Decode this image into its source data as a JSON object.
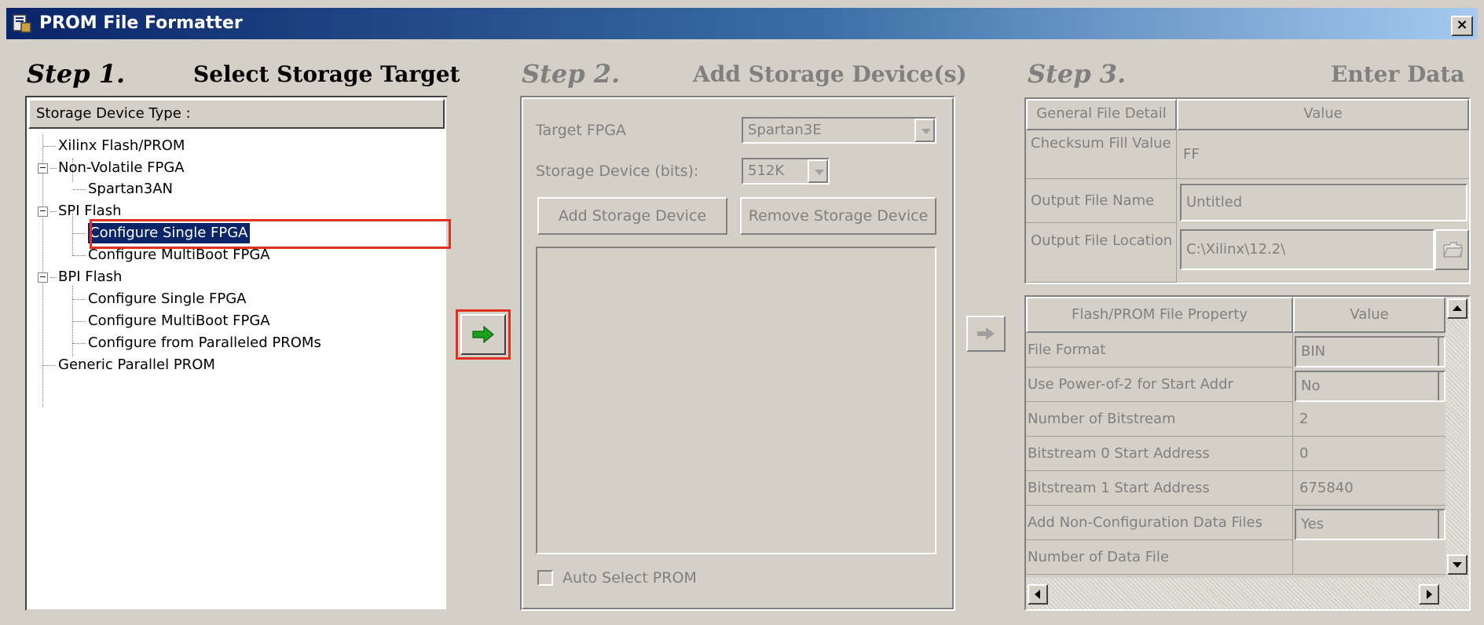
{
  "window": {
    "title": "PROM File Formatter",
    "close_glyph": "×"
  },
  "step1": {
    "num": "Step 1.",
    "title": "Select Storage Target",
    "tree_header": "Storage Device Type :",
    "items": [
      {
        "label": "Xilinx Flash/PROM"
      },
      {
        "label": "Non-Volatile FPGA",
        "expander": "−"
      },
      {
        "label": "Spartan3AN"
      },
      {
        "label": "SPI Flash",
        "expander": "−"
      },
      {
        "label": "Configure Single FPGA",
        "selected": true
      },
      {
        "label": "Configure MultiBoot FPGA"
      },
      {
        "label": "BPI Flash",
        "expander": "−"
      },
      {
        "label": "Configure Single FPGA"
      },
      {
        "label": "Configure MultiBoot FPGA"
      },
      {
        "label": "Configure from Paralleled PROMs"
      },
      {
        "label": "Generic Parallel PROM"
      }
    ]
  },
  "step2": {
    "num": "Step 2.",
    "title": "Add Storage Device(s)",
    "target_fpga_label": "Target FPGA",
    "target_fpga_value": "Spartan3E",
    "storage_device_label": "Storage Device (bits):",
    "storage_device_value": "512K",
    "add_button": "Add Storage Device",
    "remove_button": "Remove Storage Device",
    "auto_select_label": "Auto Select PROM"
  },
  "step3": {
    "num": "Step 3.",
    "title": "Enter Data",
    "general": {
      "header_detail": "General File Detail",
      "header_value": "Value",
      "rows": [
        {
          "label": "Checksum Fill Value",
          "value": "FF"
        },
        {
          "label": "Output File Name",
          "value": "Untitled"
        },
        {
          "label": "Output File Location",
          "value": "C:\\Xilinx\\12.2\\"
        }
      ]
    },
    "property": {
      "header_property": "Flash/PROM File Property",
      "header_value": "Value",
      "rows": [
        {
          "label": "File Format",
          "value": "BIN"
        },
        {
          "label": "Use Power-of-2 for Start Addr",
          "value": "No"
        },
        {
          "label": "Number of Bitstream",
          "value": "2"
        },
        {
          "label": "Bitstream 0 Start Address",
          "value": "0"
        },
        {
          "label": "Bitstream 1 Start Address",
          "value": "675840"
        },
        {
          "label": "Add Non-Configuration Data Files",
          "value": "Yes"
        },
        {
          "label": "Number of Data File",
          "value": ""
        }
      ]
    }
  },
  "icons": [
    "app-icon",
    "close-icon",
    "arrow-right-icon",
    "folder-icon",
    "expander-icon",
    "scroll-up-icon",
    "scroll-down-icon",
    "scroll-left-icon",
    "scroll-right-icon"
  ],
  "colors": {
    "selection": "#0a246a",
    "highlight": "#e03020",
    "arrow_green": "#1aa01a",
    "face": "#d4d0c8"
  }
}
